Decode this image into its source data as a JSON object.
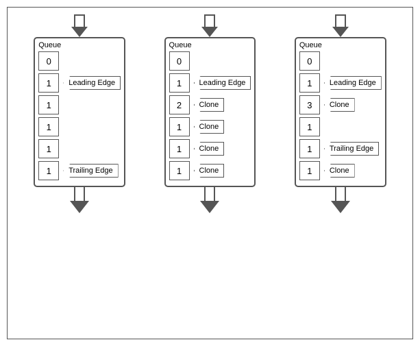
{
  "diagrams": [
    {
      "id": "diagram-1",
      "cells": [
        {
          "value": "0",
          "label": null
        },
        {
          "value": "1",
          "label": "Leading Edge"
        },
        {
          "value": "1",
          "label": null
        },
        {
          "value": "1",
          "label": null
        },
        {
          "value": "1",
          "label": null
        },
        {
          "value": "1",
          "label": "Trailing Edge"
        }
      ]
    },
    {
      "id": "diagram-2",
      "cells": [
        {
          "value": "0",
          "label": null
        },
        {
          "value": "1",
          "label": "Leading Edge"
        },
        {
          "value": "2",
          "label": "Clone"
        },
        {
          "value": "1",
          "label": "Clone"
        },
        {
          "value": "1",
          "label": "Clone"
        },
        {
          "value": "1",
          "label": "Clone"
        }
      ]
    },
    {
      "id": "diagram-3",
      "cells": [
        {
          "value": "0",
          "label": null
        },
        {
          "value": "1",
          "label": "Leading Edge"
        },
        {
          "value": "3",
          "label": "Clone"
        },
        {
          "value": "1",
          "label": null
        },
        {
          "value": "1",
          "label": "Trailing Edge"
        },
        {
          "value": "1",
          "label": "Clone"
        }
      ]
    }
  ],
  "queue_label": "Queue"
}
